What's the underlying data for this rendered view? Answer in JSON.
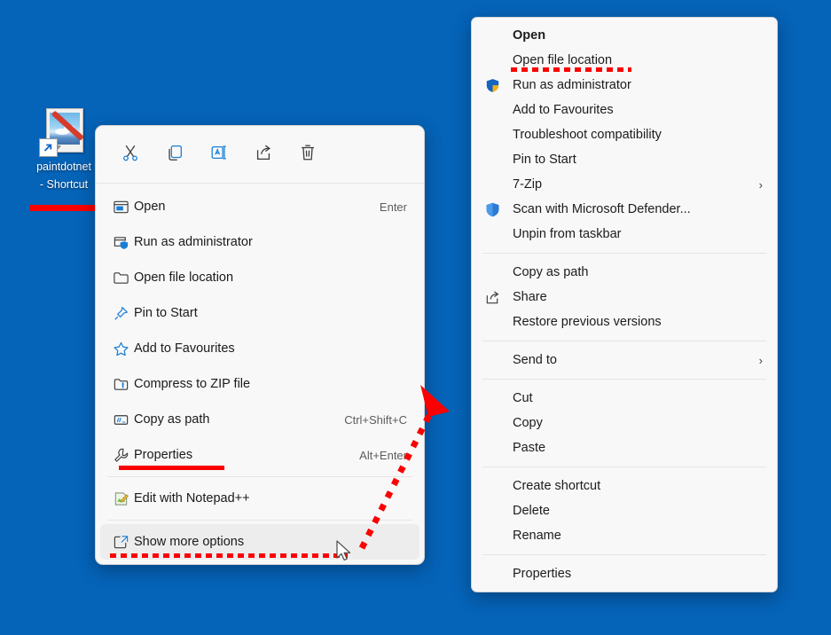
{
  "desktop": {
    "background_color": "#0563b8",
    "icon": {
      "name": "paintdotnet-shortcut-icon",
      "label_line1": "paintdotnet",
      "label_line2": "- Shortcut"
    },
    "annotations": {
      "icon_underline_color": "#fb0000",
      "arrow_color": "#fb0000",
      "arrow_style": "dashed-with-arrowhead"
    }
  },
  "win11_menu": {
    "toolbar": [
      {
        "icon": "cut-icon",
        "label": "Cut"
      },
      {
        "icon": "copy-icon",
        "label": "Copy"
      },
      {
        "icon": "rename-icon",
        "label": "Rename"
      },
      {
        "icon": "share-icon",
        "label": "Share"
      },
      {
        "icon": "delete-icon",
        "label": "Delete"
      }
    ],
    "items": [
      {
        "icon": "open-icon",
        "label": "Open",
        "accel": "Enter"
      },
      {
        "icon": "shield-window-icon",
        "label": "Run as administrator",
        "accel": ""
      },
      {
        "icon": "folder-icon",
        "label": "Open file location",
        "accel": ""
      },
      {
        "icon": "pin-icon",
        "label": "Pin to Start",
        "accel": ""
      },
      {
        "icon": "star-icon",
        "label": "Add to Favourites",
        "accel": ""
      },
      {
        "icon": "zip-icon",
        "label": "Compress to ZIP file",
        "accel": ""
      },
      {
        "icon": "copy-path-icon",
        "label": "Copy as path",
        "accel": "Ctrl+Shift+C"
      },
      {
        "icon": "wrench-icon",
        "label": "Properties",
        "accel": "Alt+Enter"
      }
    ],
    "item_notepad": {
      "icon": "notepadpp-icon",
      "label": "Edit with Notepad++",
      "accel": ""
    },
    "item_more": {
      "icon": "show-more-icon",
      "label": "Show more options",
      "accel": "",
      "hovered": true
    }
  },
  "classic_menu": {
    "group1": [
      {
        "icon": "",
        "label": "Open",
        "bold": true,
        "submenu": false
      },
      {
        "icon": "",
        "label": "Open file location",
        "bold": false,
        "submenu": false
      },
      {
        "icon": "uac-shield-icon",
        "label": "Run as administrator",
        "bold": false,
        "submenu": false
      },
      {
        "icon": "",
        "label": "Add to Favourites",
        "bold": false,
        "submenu": false
      },
      {
        "icon": "",
        "label": "Troubleshoot compatibility",
        "bold": false,
        "submenu": false
      },
      {
        "icon": "",
        "label": "Pin to Start",
        "bold": false,
        "submenu": false
      },
      {
        "icon": "",
        "label": "7-Zip",
        "bold": false,
        "submenu": true
      },
      {
        "icon": "defender-shield-icon",
        "label": "Scan with Microsoft Defender...",
        "bold": false,
        "submenu": false
      },
      {
        "icon": "",
        "label": "Unpin from taskbar",
        "bold": false,
        "submenu": false
      }
    ],
    "group2": [
      {
        "icon": "",
        "label": "Copy as path",
        "bold": false,
        "submenu": false
      },
      {
        "icon": "share-icon",
        "label": "Share",
        "bold": false,
        "submenu": false
      },
      {
        "icon": "",
        "label": "Restore previous versions",
        "bold": false,
        "submenu": false
      }
    ],
    "group3": [
      {
        "icon": "",
        "label": "Send to",
        "bold": false,
        "submenu": true
      }
    ],
    "group4": [
      {
        "icon": "",
        "label": "Cut",
        "bold": false,
        "submenu": false
      },
      {
        "icon": "",
        "label": "Copy",
        "bold": false,
        "submenu": false
      },
      {
        "icon": "",
        "label": "Paste",
        "bold": false,
        "submenu": false
      }
    ],
    "group5": [
      {
        "icon": "",
        "label": "Create shortcut",
        "bold": false,
        "submenu": false
      },
      {
        "icon": "",
        "label": "Delete",
        "bold": false,
        "submenu": false
      },
      {
        "icon": "",
        "label": "Rename",
        "bold": false,
        "submenu": false
      }
    ],
    "group6": [
      {
        "icon": "",
        "label": "Properties",
        "bold": false,
        "submenu": false
      }
    ],
    "chevron_glyph": "›"
  }
}
